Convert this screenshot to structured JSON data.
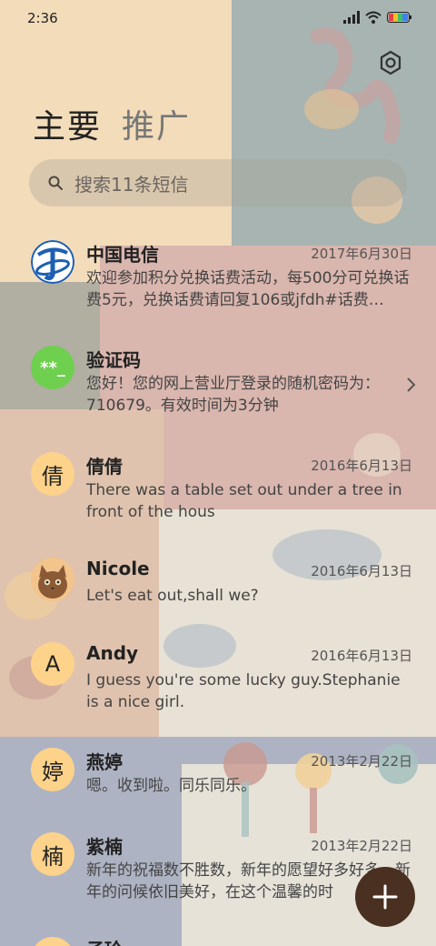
{
  "status_bar": {
    "time": "2:36"
  },
  "tabs": {
    "active": "主要",
    "inactive": "推广"
  },
  "search": {
    "placeholder": "搜索11条短信"
  },
  "messages": [
    {
      "name": "中国电信",
      "date": "2017年6月30日",
      "preview": "欢迎参加积分兑换话费活动，每500分可兑换话费5元，兑换话费请回复106或jfdh#话费…",
      "avatar_type": "logo-telecom",
      "avatar_text": ""
    },
    {
      "name": "验证码",
      "date": "",
      "preview": "您好！您的网上营业厅登录的随机密码为：710679。有效时间为3分钟",
      "avatar_type": "code",
      "avatar_text": "**_"
    },
    {
      "name": "倩倩",
      "date": "2016年6月13日",
      "preview": "There was a table set out under a tree in front of the hous",
      "avatar_type": "letter",
      "avatar_text": "倩"
    },
    {
      "name": "Nicole",
      "date": "2016年6月13日",
      "preview": "Let's eat out,shall we?",
      "avatar_type": "photo-cat",
      "avatar_text": ""
    },
    {
      "name": "Andy",
      "date": "2016年6月13日",
      "preview": "I guess you're some lucky guy.Stephanie is a nice girl.",
      "avatar_type": "letter",
      "avatar_text": "A"
    },
    {
      "name": "燕婷",
      "date": "2013年2月22日",
      "preview": "嗯。收到啦。同乐同乐。",
      "avatar_type": "letter",
      "avatar_text": "婷"
    },
    {
      "name": "紫楠",
      "date": "2013年2月22日",
      "preview": "新年的祝福数不胜数，新年的愿望好多好多，新年的问候依旧美好，在这个温馨的时",
      "avatar_type": "letter",
      "avatar_text": "楠"
    },
    {
      "name": "子玲",
      "date": "",
      "preview": "",
      "avatar_type": "letter",
      "avatar_text": ""
    }
  ],
  "colors": {
    "avatar_letter_bg": "#fdd28a",
    "fab": "#4a3020",
    "code_avatar": "#6fcf4f",
    "telecom_blue": "#1d5fb3"
  },
  "icons": {
    "settings": "gear-icon",
    "search": "search-icon",
    "compose": "plus-icon",
    "chevron": "chevron-right-icon"
  }
}
